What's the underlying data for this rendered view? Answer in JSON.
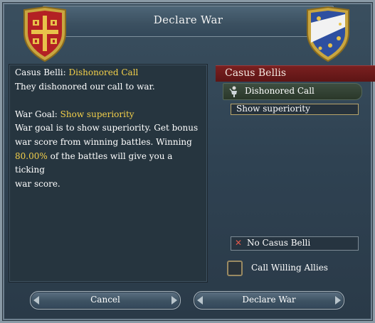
{
  "window": {
    "title": "Declare War"
  },
  "info": {
    "casus_belli_label": "Casus Belli:",
    "casus_belli_value": "Dishonored Call",
    "casus_belli_desc": "They dishonored our call to war.",
    "war_goal_label": "War Goal:",
    "war_goal_value": "Show superiority",
    "war_goal_line1": "War goal is to show superiority. Get bonus",
    "war_goal_line2": "war score from winning battles. Winning",
    "war_goal_pct": "80.00%",
    "war_goal_line3_rest": "of the battles will give you a ticking",
    "war_goal_line4": "war score."
  },
  "casus_bellis": {
    "header": "Casus Bellis",
    "selected": "Dishonored Call",
    "war_goal": "Show superiority",
    "no_cb": "No Casus Belli"
  },
  "allies": {
    "label": "Call Willing Allies",
    "checked": false
  },
  "buttons": {
    "cancel": "Cancel",
    "declare": "Declare War"
  },
  "colors": {
    "highlight": "#f4d04a",
    "cb_header": "#6a1a1a",
    "left_shield": "#b32124",
    "right_shield": "#2e4fa0"
  },
  "icons": {
    "left_emblem": "byzantine-cross-shield-icon",
    "right_emblem": "fleur-de-lis-shield-icon",
    "cb_icon": "soldier-icon",
    "no_cb_icon": "x-mark-icon"
  }
}
